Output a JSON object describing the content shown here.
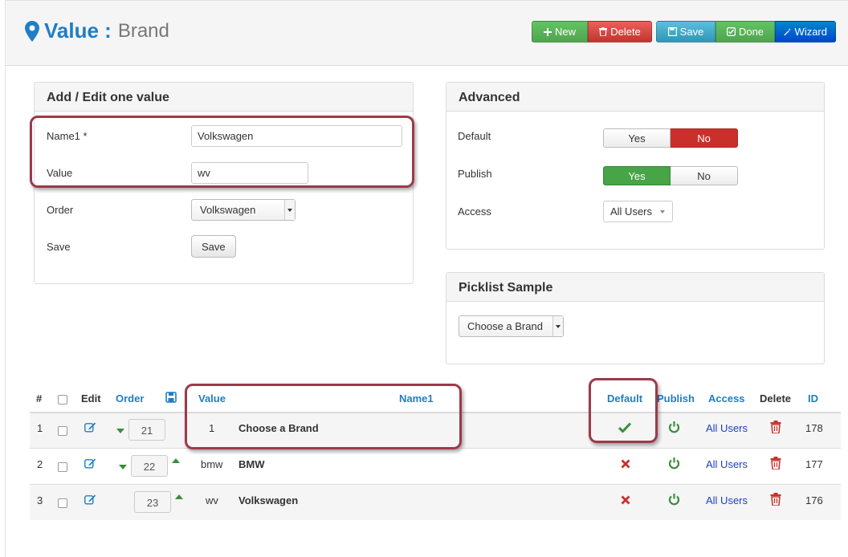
{
  "header": {
    "title_main": "Value :",
    "title_sub": "Brand",
    "toolbar": {
      "new_label": "New",
      "delete_label": "Delete",
      "save_label": "Save",
      "done_label": "Done",
      "wizard_label": "Wizard"
    }
  },
  "edit_panel": {
    "title": "Add / Edit one value",
    "name_label": "Name1",
    "required_mark": "*",
    "name_value": "Volkswagen",
    "value_label": "Value",
    "value_value": "wv",
    "order_label": "Order",
    "order_selected": "Volkswagen",
    "save_label": "Save",
    "save_button": "Save"
  },
  "advanced_panel": {
    "title": "Advanced",
    "default_label": "Default",
    "default_options": [
      "Yes",
      "No"
    ],
    "default_selected": "No",
    "publish_label": "Publish",
    "publish_options": [
      "Yes",
      "No"
    ],
    "publish_selected": "Yes",
    "access_label": "Access",
    "access_selected": "All Users"
  },
  "picklist_panel": {
    "title": "Picklist Sample",
    "select_value": "Choose a Brand"
  },
  "table": {
    "headers": {
      "num": "#",
      "edit": "Edit",
      "order": "Order",
      "value": "Value",
      "name1": "Name1",
      "default": "Default",
      "publish": "Publish",
      "access": "Access",
      "delete": "Delete",
      "id": "ID"
    },
    "rows": [
      {
        "num": "1",
        "order": "21",
        "value": "1",
        "name": "Choose a Brand",
        "default": true,
        "access": "All Users",
        "id": "178"
      },
      {
        "num": "2",
        "order": "22",
        "value": "bmw",
        "name": "BMW",
        "default": false,
        "access": "All Users",
        "id": "177"
      },
      {
        "num": "3",
        "order": "23",
        "value": "wv",
        "name": "Volkswagen",
        "default": false,
        "access": "All Users",
        "id": "176"
      }
    ]
  },
  "colors": {
    "accent_blue": "#1f7ec4",
    "callout": "#9c3a4a",
    "green": "#47a447",
    "red": "#c9302c"
  }
}
